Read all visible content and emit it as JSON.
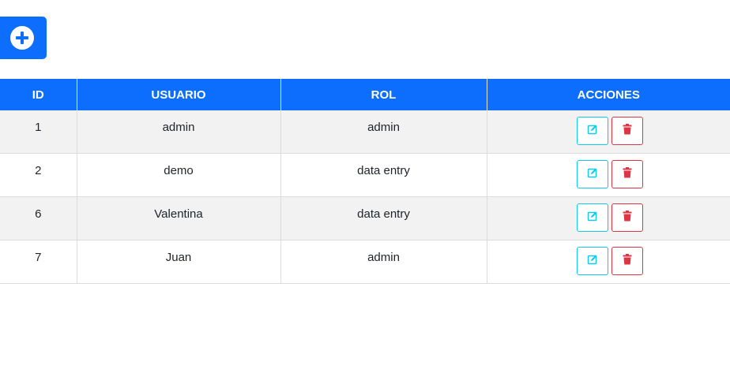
{
  "toolbar": {
    "add_icon": "plus-circle-icon",
    "accent_color": "#0d6efd"
  },
  "table": {
    "headers": {
      "id": "ID",
      "user": "USUARIO",
      "role": "ROL",
      "actions": "ACCIONES"
    },
    "rows": [
      {
        "id": "1",
        "user": "admin",
        "role": "admin"
      },
      {
        "id": "2",
        "user": "demo",
        "role": "data entry"
      },
      {
        "id": "6",
        "user": "Valentina",
        "role": "data entry"
      },
      {
        "id": "7",
        "user": "Juan",
        "role": "admin"
      }
    ],
    "row_actions": {
      "edit_icon": "edit-icon",
      "edit_color": "#0dcaf0",
      "delete_icon": "trash-icon",
      "delete_color": "#dc3545"
    },
    "header_color": "#0d6efd",
    "stripe_color": "#f2f2f2"
  }
}
